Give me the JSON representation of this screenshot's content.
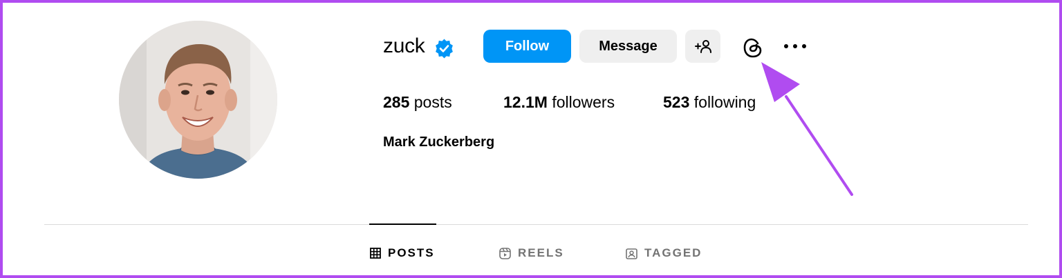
{
  "profile": {
    "username": "zuck",
    "full_name": "Mark Zuckerberg",
    "verified_badge_icon": "verified-badge-icon",
    "avatar_alt": "profile-photo"
  },
  "actions": {
    "follow_label": "Follow",
    "message_label": "Message",
    "add_user_icon": "person-add-icon",
    "threads_icon": "threads-icon",
    "more_icon": "ellipsis-icon"
  },
  "stats": {
    "posts_count": "285",
    "posts_label": " posts",
    "followers_count": "12.1M",
    "followers_label": " followers",
    "following_count": "523",
    "following_label": " following"
  },
  "tabs": [
    {
      "label": "POSTS",
      "icon": "grid-icon",
      "active": true
    },
    {
      "label": "REELS",
      "icon": "reels-icon",
      "active": false
    },
    {
      "label": "TAGGED",
      "icon": "tagged-icon",
      "active": false
    }
  ],
  "colors": {
    "follow_button": "#0095f6",
    "secondary_button": "#efefef",
    "verified_badge": "#0095f6",
    "annotation_arrow": "#b04cf0",
    "frame_border": "#b04cf0",
    "inactive_tab_text": "#737373"
  }
}
